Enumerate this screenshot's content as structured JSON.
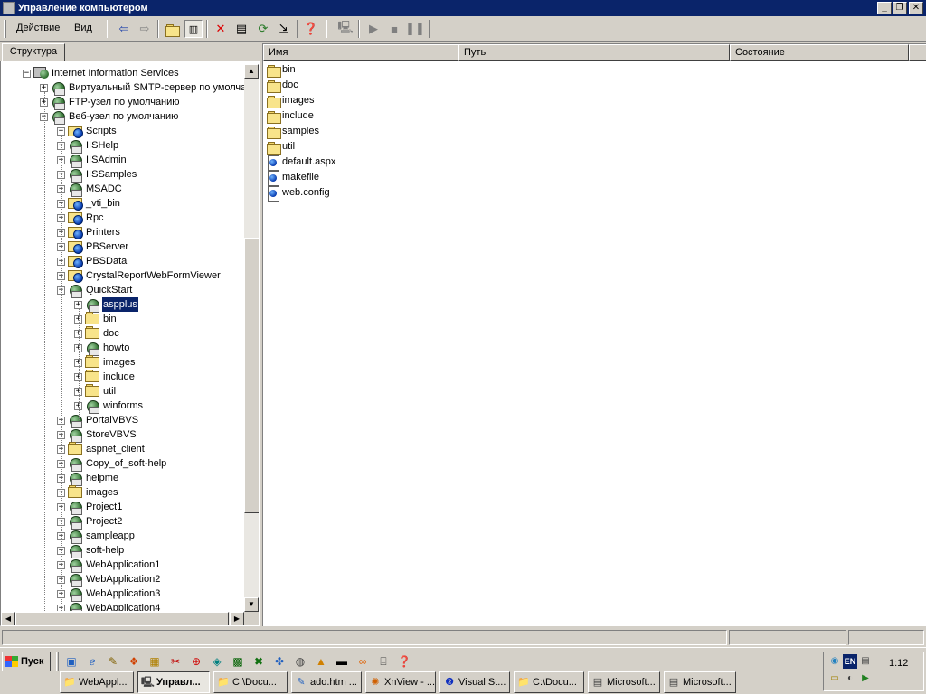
{
  "window": {
    "title": "Управление компьютером"
  },
  "menu": {
    "action": "Действие",
    "view": "Вид"
  },
  "tabs": {
    "structure": "Структура"
  },
  "tree": {
    "root": "Internet Information Services",
    "smtp": "Виртуальный SMTP-сервер по умолча",
    "ftp": "FTP-узел по умолчанию",
    "web": "Веб-узел по умолчанию",
    "web_children": [
      "Scripts",
      "IISHelp",
      "IISAdmin",
      "IISSamples",
      "MSADC",
      "_vti_bin",
      "Rpc",
      "Printers",
      "PBServer",
      "PBSData",
      "CrystalReportWebFormViewer"
    ],
    "quickstart": "QuickStart",
    "quickstart_children": [
      "aspplus",
      "bin",
      "doc",
      "howto",
      "images",
      "include",
      "util",
      "winforms"
    ],
    "web_children_after": [
      "PortalVBVS",
      "StoreVBVS",
      "aspnet_client",
      "Copy_of_soft-help",
      "helpme",
      "images",
      "Project1",
      "Project2",
      "sampleapp",
      "soft-help",
      "WebApplication1",
      "WebApplication2",
      "WebApplication3",
      "WebApplication4"
    ],
    "selected": "aspplus"
  },
  "list": {
    "columns": [
      "Имя",
      "Путь",
      "Состояние"
    ],
    "items": [
      {
        "name": "bin",
        "type": "folder"
      },
      {
        "name": "doc",
        "type": "folder"
      },
      {
        "name": "images",
        "type": "folder"
      },
      {
        "name": "include",
        "type": "folder"
      },
      {
        "name": "samples",
        "type": "folder"
      },
      {
        "name": "util",
        "type": "folder"
      },
      {
        "name": "default.aspx",
        "type": "file"
      },
      {
        "name": "makefile",
        "type": "file"
      },
      {
        "name": "web.config",
        "type": "file"
      }
    ]
  },
  "taskbar": {
    "start": "Пуск",
    "clock": "1:12",
    "lang": "EN",
    "buttons": [
      {
        "label": "WebAppl...",
        "icon": "folder-icon"
      },
      {
        "label": "Управл...",
        "icon": "computer-management-icon",
        "active": true
      },
      {
        "label": "C:\\Docu...",
        "icon": "folder-icon"
      },
      {
        "label": "ado.htm ...",
        "icon": "document-icon"
      },
      {
        "label": "XnView - ...",
        "icon": "xnview-icon"
      },
      {
        "label": "Visual St...",
        "icon": "visual-studio-icon"
      },
      {
        "label": "C:\\Docu...",
        "icon": "folder-icon"
      },
      {
        "label": "Microsoft...",
        "icon": "application-icon"
      },
      {
        "label": "Microsoft...",
        "icon": "application-icon"
      }
    ]
  }
}
